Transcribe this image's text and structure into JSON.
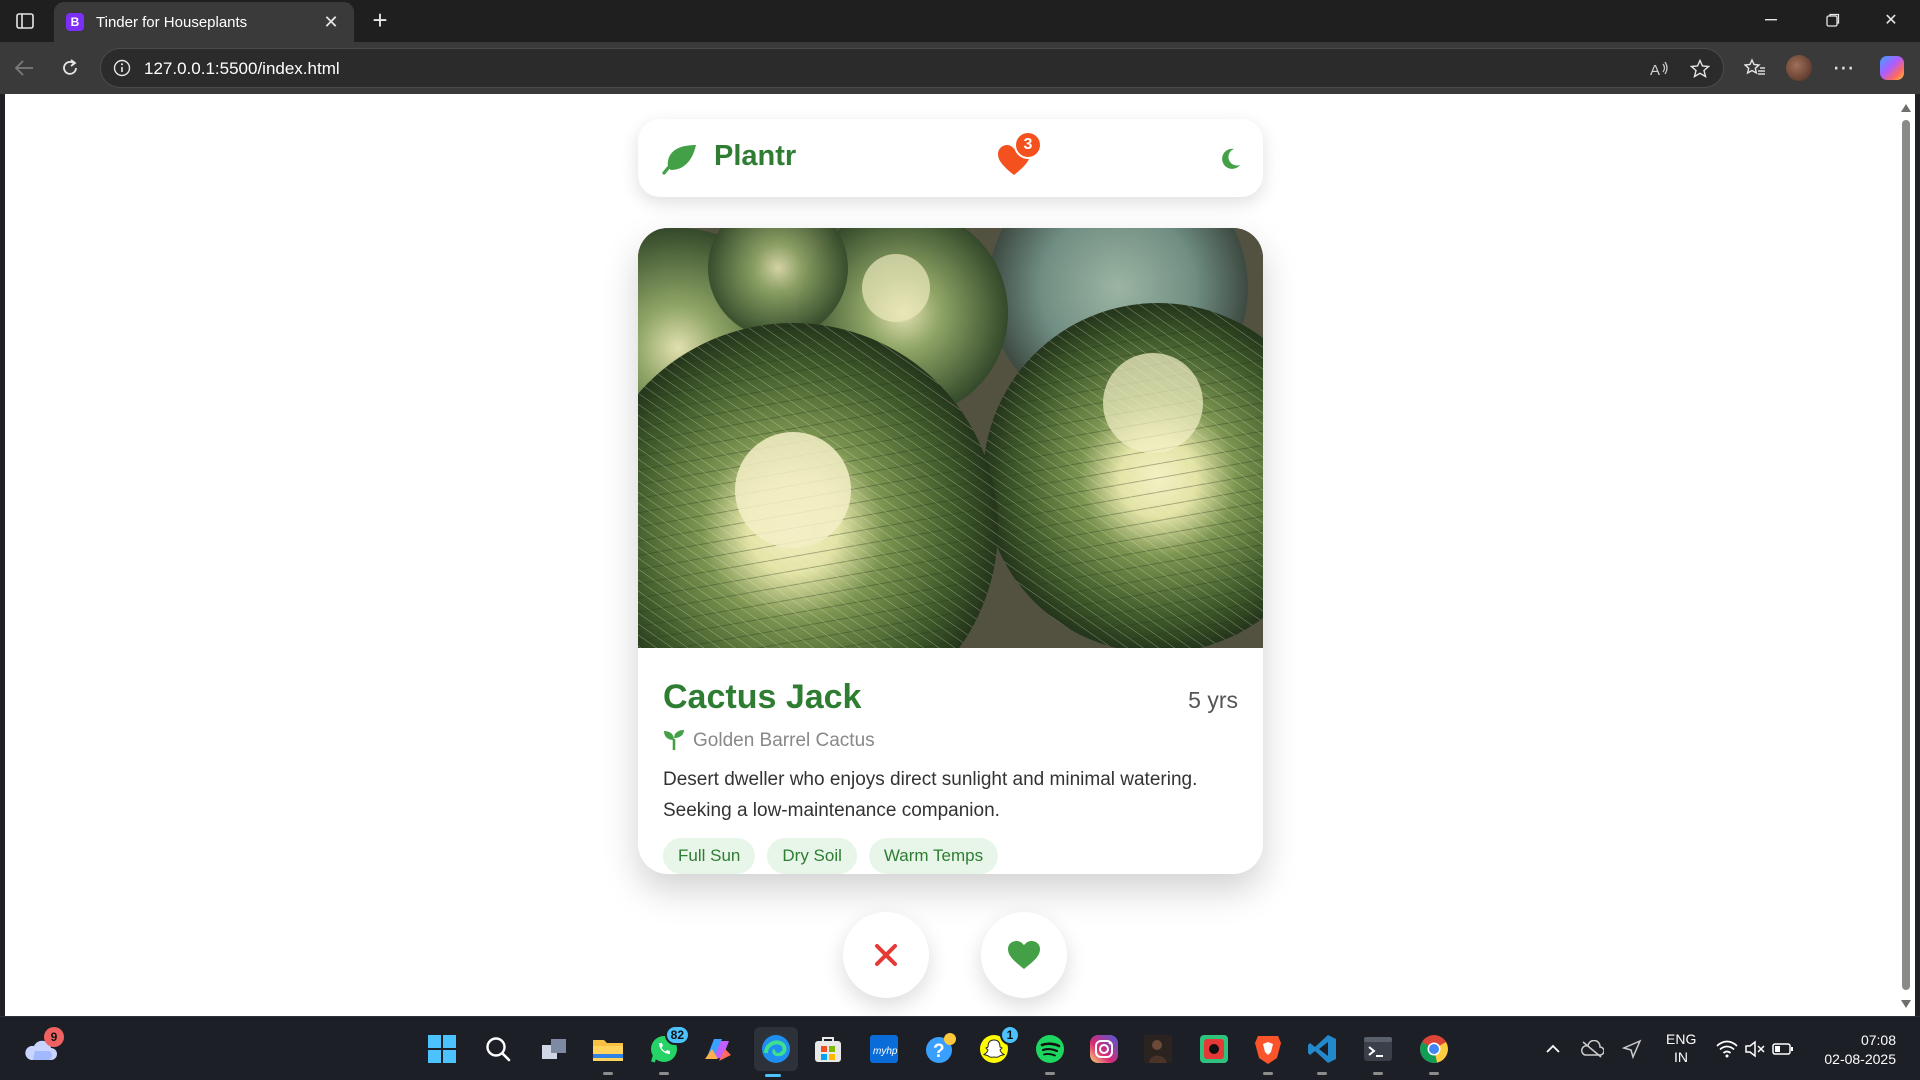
{
  "browser": {
    "tab_title": "Tinder for Houseplants",
    "tab_favicon_letter": "B",
    "url": "127.0.0.1:5500/index.html"
  },
  "app": {
    "logo_text": "Plantr",
    "likes_count": "3",
    "colors": {
      "brand_green": "#2e7d32",
      "badge_orange": "#f4511e",
      "like_green": "#43a047",
      "reject_red": "#e53935",
      "heart_orange": "#f4511e"
    }
  },
  "card": {
    "name": "Cactus Jack",
    "age": "5 yrs",
    "species": "Golden Barrel Cactus",
    "bio": "Desert dweller who enjoys direct sunlight and minimal watering. Seeking a low-maintenance companion.",
    "tags": [
      "Full Sun",
      "Dry Soil",
      "Warm Temps"
    ]
  },
  "taskbar": {
    "weather_badge": "9",
    "whatsapp_badge": "82",
    "snapchat_badge": "1",
    "language": "ENG",
    "region": "IN",
    "time": "07:08",
    "date": "02-08-2025"
  }
}
